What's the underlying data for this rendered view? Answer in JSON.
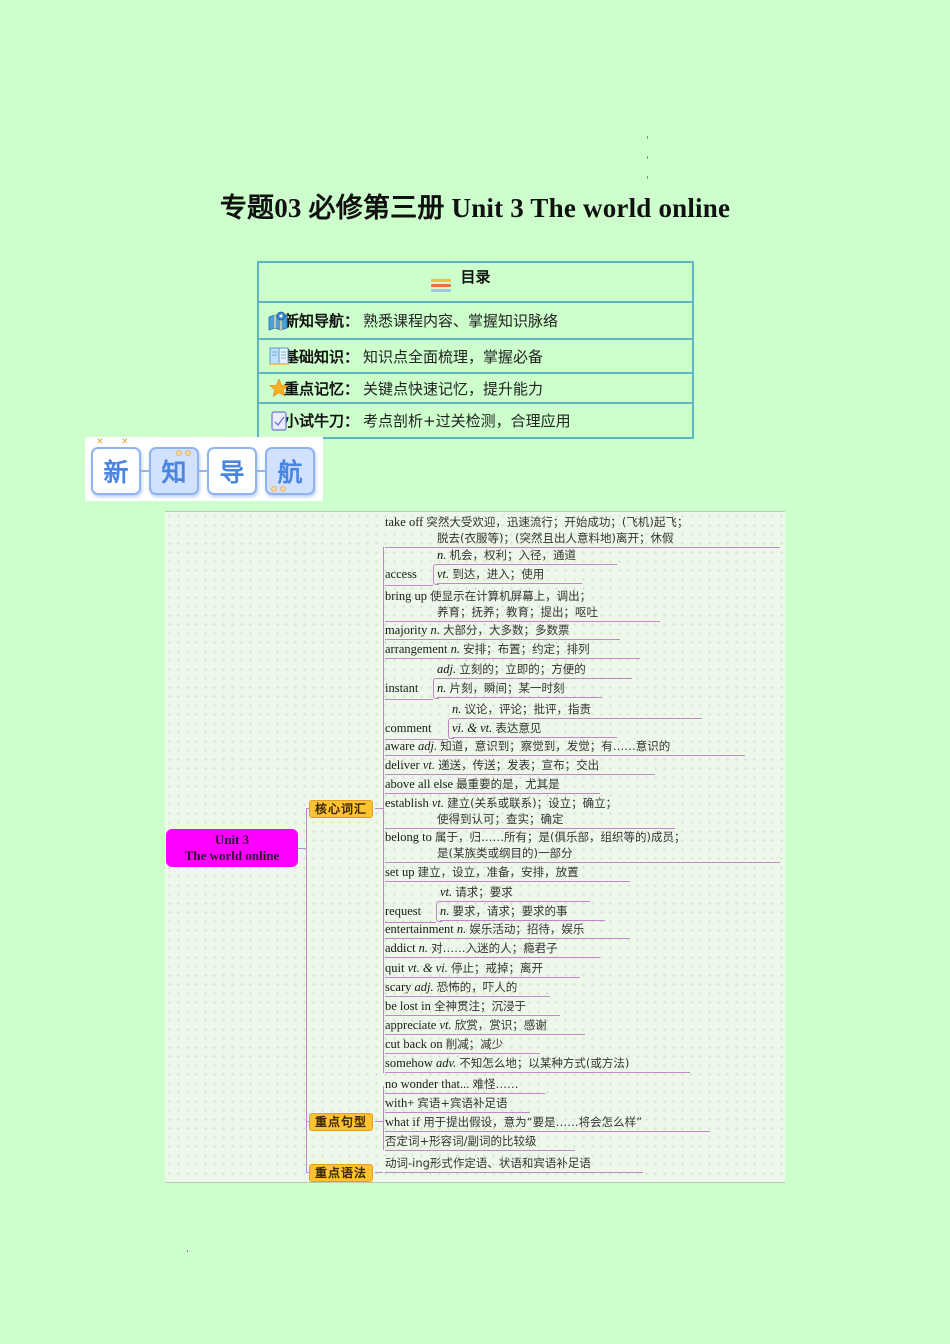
{
  "title": "专题03 必修第三册  Unit 3 The world online",
  "toc": {
    "heading": "目录",
    "rows": [
      {
        "icon": "map-pin-icon",
        "label": "新知导航",
        "sep": "：",
        "desc": "熟悉课程内容、掌握知识脉络"
      },
      {
        "icon": "book-icon",
        "label": "基础知识",
        "sep": "：",
        "desc": "知识点全面梳理，掌握必备"
      },
      {
        "icon": "star-icon",
        "label": "重点记忆",
        "sep": "：",
        "desc": "关键点快速记忆，提升能力"
      },
      {
        "icon": "edit-icon",
        "label": "小试牛刀",
        "sep": "：",
        "desc": "考点剖析+过关检测，合理应用"
      }
    ]
  },
  "banner": {
    "chars": [
      "新",
      "知",
      "导",
      "航"
    ]
  },
  "mindmap": {
    "root": {
      "line1": "Unit 3",
      "line2": "The world online"
    },
    "branches": [
      {
        "label": "核心词汇"
      },
      {
        "label": "重点句型"
      },
      {
        "label": "重点语法"
      }
    ],
    "vocab": [
      {
        "en": "take off",
        "pos": "",
        "cn": "突然大受欢迎，迅速流行；开始成功；(飞机)起飞；",
        "cn2": "脱去(衣服等)；(突然且出人意料地)离开；休假"
      },
      {
        "en": "access",
        "senses": [
          {
            "pos": "n.",
            "cn": "机会，权利；入径，通道"
          },
          {
            "pos": "vt.",
            "cn": "到达，进入；使用"
          }
        ]
      },
      {
        "en": "bring up",
        "pos": "",
        "cn": "使显示在计算机屏幕上，调出；",
        "cn2": "养育；抚养；教育；提出；呕吐"
      },
      {
        "en": "majority",
        "pos": "n.",
        "cn": "大部分，大多数；多数票"
      },
      {
        "en": "arrangement",
        "pos": "n.",
        "cn": "安排；布置；约定；排列"
      },
      {
        "en": "instant",
        "senses": [
          {
            "pos": "adj.",
            "cn": "立刻的；立即的；方便的"
          },
          {
            "pos": "n.",
            "cn": "片刻，瞬间；某一时刻"
          }
        ]
      },
      {
        "en": "comment",
        "senses": [
          {
            "pos": "n.",
            "cn": "议论，评论；批评，指责"
          },
          {
            "pos": "vi. & vt.",
            "cn": "表达意见"
          }
        ]
      },
      {
        "en": "aware",
        "pos": "adj.",
        "cn": "知道，意识到；察觉到，发觉；有……意识的"
      },
      {
        "en": "deliver",
        "pos": "vt.",
        "cn": "递送，传送；发表；宣布；交出"
      },
      {
        "en": "above all else",
        "pos": "",
        "cn": "最重要的是，尤其是"
      },
      {
        "en": "establish",
        "pos": "vt.",
        "cn": "建立(关系或联系)；设立；确立；",
        "cn2": "使得到认可；查实；确定"
      },
      {
        "en": "belong to",
        "pos": "",
        "cn": "属于，归……所有；是(俱乐部，组织等的)成员；",
        "cn2": "是(某族类或纲目的)一部分"
      },
      {
        "en": "set up",
        "pos": "",
        "cn": "建立，设立，准备，安排，放置"
      },
      {
        "en": "request",
        "senses": [
          {
            "pos": "vt.",
            "cn": "请求；要求"
          },
          {
            "pos": "n.",
            "cn": "要求，请求；要求的事"
          }
        ]
      },
      {
        "en": "entertainment",
        "pos": "n.",
        "cn": "娱乐活动；招待，娱乐"
      },
      {
        "en": "addict",
        "pos": "n.",
        "cn": "对……入迷的人；瘾君子"
      },
      {
        "en": "quit",
        "pos": "vt. & vi.",
        "cn": "停止；戒掉；离开"
      },
      {
        "en": "scary",
        "pos": "adj.",
        "cn": "恐怖的，吓人的"
      },
      {
        "en": "be lost in",
        "pos": "",
        "cn": "全神贯注；沉浸于"
      },
      {
        "en": "appreciate",
        "pos": "vt.",
        "cn": "欣赏，赏识；感谢"
      },
      {
        "en": "cut back on",
        "pos": "",
        "cn": "削减；减少"
      },
      {
        "en": "somehow",
        "pos": "adv.",
        "cn": "不知怎么地；以某种方式(或方法)"
      }
    ],
    "sentences": [
      {
        "en": "no wonder that...",
        "cn": "难怪……"
      },
      {
        "en": "with+",
        "cn": "宾语+宾语补足语"
      },
      {
        "en": "what if",
        "cn": "用于提出假设，意为“要是……将会怎么样”"
      },
      {
        "en": "",
        "cn": "否定词+形容词/副词的比较级"
      }
    ],
    "grammar": [
      {
        "en": "",
        "cn": "动词-ing形式作定语、状语和宾语补足语"
      }
    ]
  },
  "colors": {
    "page_bg": "#ccffcc",
    "toc_border": "#5fb5c0",
    "root_bg": "#ff00ff",
    "branch_bg": "#ffc233",
    "connector": "#c088c8",
    "banner_blue": "#4a86e0"
  }
}
